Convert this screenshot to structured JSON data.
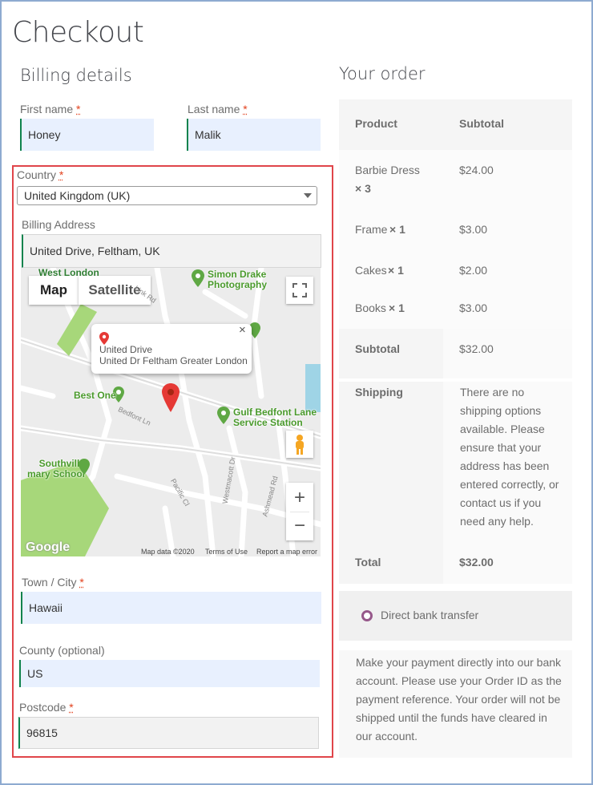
{
  "page_title": "Checkout",
  "billing": {
    "heading": "Billing details",
    "first_name_label": "First name",
    "first_name_value": "Honey",
    "last_name_label": "Last name",
    "last_name_value": "Malik",
    "country_label": "Country",
    "country_value": "United Kingdom (UK)",
    "address_label": "Billing Address",
    "address_value": "United Drive, Feltham, UK",
    "town_label": "Town / City",
    "town_value": "Hawaii",
    "county_label": "County (optional)",
    "county_value": "US",
    "postcode_label": "Postcode",
    "postcode_value": "96815",
    "required_mark": "*"
  },
  "map": {
    "map_tab": "Map",
    "satellite_tab": "Satellite",
    "infowindow_title": "United Drive",
    "infowindow_address": "United Dr Feltham Greater London",
    "place_west_london": "West London",
    "place_simon_drake": "Simon Drake Photography",
    "place_best_one": "Best One",
    "place_gulf_bedfont": "Gulf Bedfont Lane Service Station",
    "place_southville": "Southville mary School",
    "street_link_rd": "Link Rd",
    "street_bedfont_ln": "Bedfont Ln",
    "street_pacific_cl": "Pacific Cl",
    "street_westmacott_dr": "Westmacott Dr",
    "street_ashmead_rd": "Ashmead Rd",
    "google_logo": "Google",
    "map_data": "Map data ©2020",
    "terms": "Terms of Use",
    "report": "Report a map error",
    "zoom_in": "+",
    "zoom_out": "−",
    "close": "×"
  },
  "order": {
    "heading": "Your order",
    "col_product": "Product",
    "col_subtotal": "Subtotal",
    "items": [
      {
        "name": "Barbie Dress",
        "qty": "× 3",
        "price": "$24.00"
      },
      {
        "name": "Frame",
        "qty": "× 1",
        "price": "$3.00"
      },
      {
        "name": "Cakes",
        "qty": "× 1",
        "price": "$2.00"
      },
      {
        "name": "Books",
        "qty": "× 1",
        "price": "$3.00"
      }
    ],
    "subtotal_label": "Subtotal",
    "subtotal_value": "$32.00",
    "shipping_label": "Shipping",
    "shipping_value": "There are no shipping options available. Please ensure that your address has been entered correctly, or contact us if you need any help.",
    "total_label": "Total",
    "total_value": "$32.00"
  },
  "payment": {
    "method_label": "Direct bank transfer",
    "description": "Make your payment directly into our bank account. Please use your Order ID as the payment reference. Your order will not be shipped until the funds have cleared in our account.",
    "accent_color": "#96588a"
  }
}
